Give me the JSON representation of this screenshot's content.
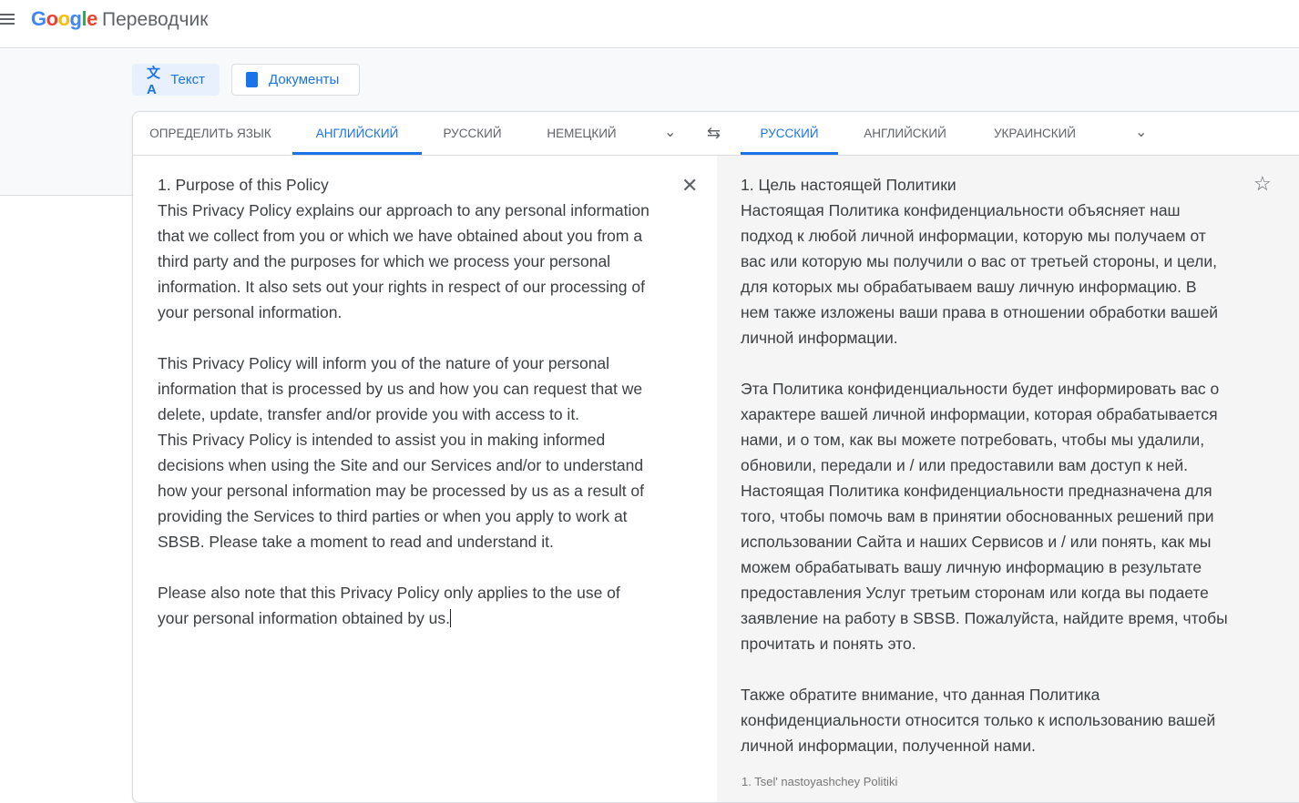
{
  "header": {
    "logo": "Google",
    "product": "Переводчик"
  },
  "modes": {
    "text": "Текст",
    "documents": "Документы"
  },
  "source_tabs": [
    "ОПРЕДЕЛИТЬ ЯЗЫК",
    "АНГЛИЙСКИЙ",
    "РУССКИЙ",
    "НЕМЕЦКИЙ"
  ],
  "target_tabs": [
    "РУССКИЙ",
    "АНГЛИЙСКИЙ",
    "УКРАИНСКИЙ"
  ],
  "source_lines": [
    "1. Purpose of this Policy",
    "This Privacy Policy explains our approach to any personal information",
    "that we collect from you or which we have obtained about you from a",
    "third party and the purposes for which we process your personal",
    "information. It also sets out your rights in respect of our processing of",
    "your personal information.",
    "",
    "This Privacy Policy will inform you of the nature of your personal",
    "information that is processed by us and how you can request that we",
    "delete, update, transfer and/or provide you with access to it.",
    "This Privacy Policy is intended to assist you in making informed",
    "decisions when using the Site and our Services and/or to understand",
    "how your personal information may be processed by us as a result of",
    "providing the Services to third parties or when you apply to work at",
    "SBSB. Please take a moment to read and understand it.",
    "",
    "Please also note that this Privacy Policy only applies to the use of",
    "your personal information obtained by us."
  ],
  "target_lines": [
    "1. Цель настоящей Политики",
    "Настоящая Политика конфиденциальности объясняет наш",
    "подход к любой личной информации, которую мы получаем от",
    "вас или которую мы получили о вас от третьей стороны, и цели,",
    "для которых мы обрабатываем вашу личную информацию. В",
    "нем также изложены ваши права в отношении обработки вашей",
    "личной информации.",
    "",
    "Эта Политика конфиденциальности будет информировать вас о",
    "характере вашей личной информации, которая обрабатывается",
    "нами, и о том, как вы можете потребовать, чтобы мы удалили,",
    "обновили, передали и / или предоставили вам доступ к ней.",
    "Настоящая Политика конфиденциальности предназначена для",
    "того, чтобы помочь вам в принятии обоснованных решений при",
    "использовании Сайта и наших Сервисов и / или понять, как мы",
    "можем обрабатывать вашу личную информацию в результате",
    "предоставления Услуг третьим сторонам или когда вы подаете",
    "заявление на работу в SBSB. Пожалуйста, найдите время, чтобы",
    "прочитать и понять это.",
    "",
    "Также обратите внимание, что данная Политика",
    "конфиденциальности относится только к использованию вашей",
    "личной информации, полученной нами."
  ],
  "romanization": "1. Tsel' nastoyashchey Politiki",
  "colors": {
    "accent": "#1a73e8",
    "output_bg": "#f5f5f5"
  }
}
